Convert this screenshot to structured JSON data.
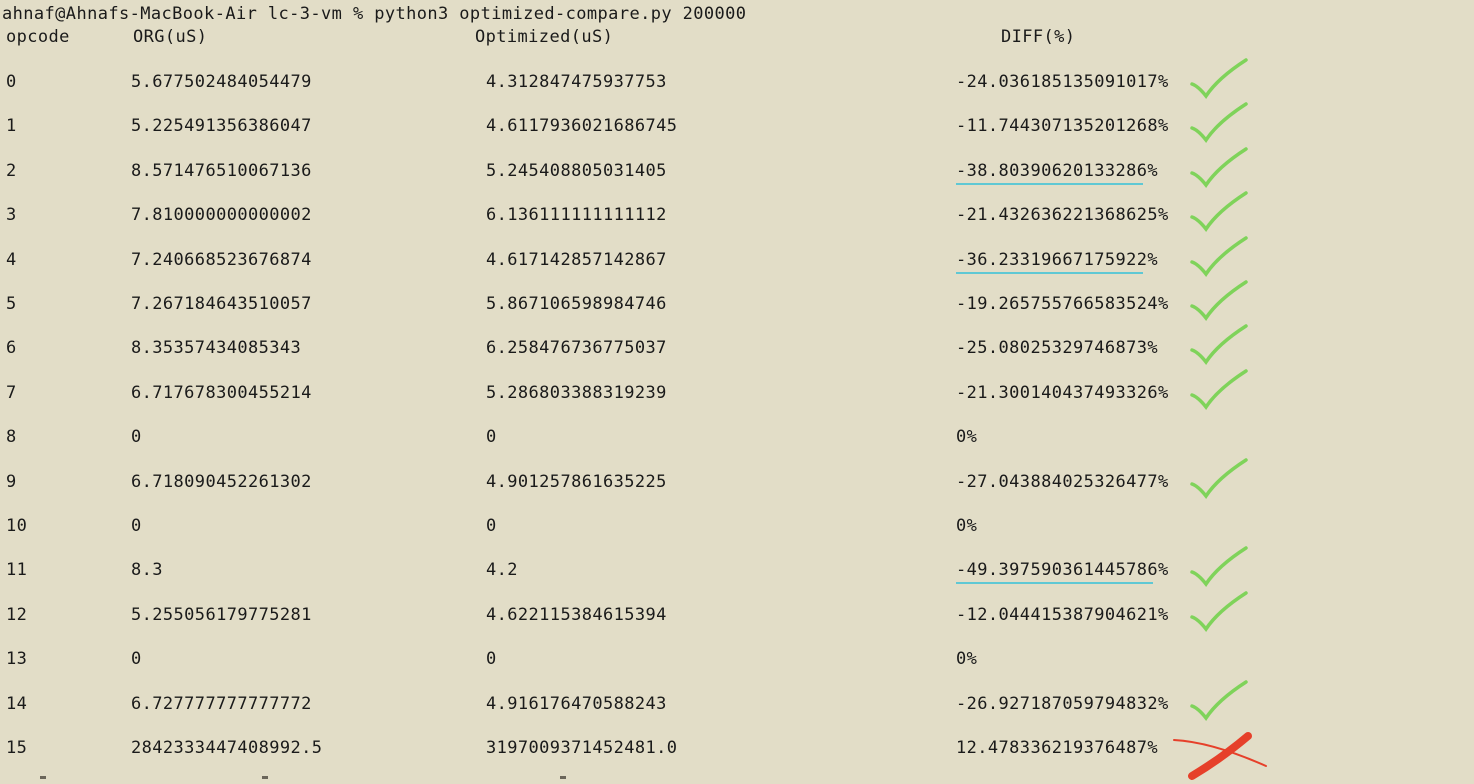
{
  "terminal": {
    "prompt": "ahnaf@Ahnafs-MacBook-Air lc-3-vm % python3 optimized-compare.py 200000",
    "headers": {
      "opcode": "opcode",
      "org": "ORG(uS)",
      "optimized": "Optimized(uS)",
      "diff": "DIFF(%)"
    },
    "rows": [
      {
        "opcode": "0",
        "org": "5.677502484054479",
        "optimized": "4.312847475937753",
        "diff": "-24.036185135091017%",
        "mark": "check",
        "underlined": false
      },
      {
        "opcode": "1",
        "org": "5.225491356386047",
        "optimized": "4.6117936021686745",
        "diff": "-11.744307135201268%",
        "mark": "check",
        "underlined": false
      },
      {
        "opcode": "2",
        "org": "8.571476510067136",
        "optimized": "5.245408805031405",
        "diff": "-38.80390620133286%",
        "mark": "check",
        "underlined": true
      },
      {
        "opcode": "3",
        "org": "7.810000000000002",
        "optimized": "6.136111111111112",
        "diff": "-21.432636221368625%",
        "mark": "check",
        "underlined": false
      },
      {
        "opcode": "4",
        "org": "7.240668523676874",
        "optimized": "4.617142857142867",
        "diff": "-36.23319667175922%",
        "mark": "check",
        "underlined": true
      },
      {
        "opcode": "5",
        "org": "7.267184643510057",
        "optimized": "5.867106598984746",
        "diff": "-19.265755766583524%",
        "mark": "check",
        "underlined": false
      },
      {
        "opcode": "6",
        "org": "8.35357434085343",
        "optimized": "6.258476736775037",
        "diff": "-25.08025329746873%",
        "mark": "check",
        "underlined": false
      },
      {
        "opcode": "7",
        "org": "6.717678300455214",
        "optimized": "5.286803388319239",
        "diff": "-21.300140437493326%",
        "mark": "check",
        "underlined": false
      },
      {
        "opcode": "8",
        "org": "0",
        "optimized": "0",
        "diff": "0%",
        "mark": "none",
        "underlined": false
      },
      {
        "opcode": "9",
        "org": "6.718090452261302",
        "optimized": "4.901257861635225",
        "diff": "-27.043884025326477%",
        "mark": "check",
        "underlined": false
      },
      {
        "opcode": "10",
        "org": "0",
        "optimized": "0",
        "diff": "0%",
        "mark": "none",
        "underlined": false
      },
      {
        "opcode": "11",
        "org": "8.3",
        "optimized": "4.2",
        "diff": "-49.397590361445786%",
        "mark": "check",
        "underlined": true
      },
      {
        "opcode": "12",
        "org": "5.255056179775281",
        "optimized": "4.622115384615394",
        "diff": "-12.044415387904621%",
        "mark": "check",
        "underlined": false
      },
      {
        "opcode": "13",
        "org": "0",
        "optimized": "0",
        "diff": "0%",
        "mark": "none",
        "underlined": false
      },
      {
        "opcode": "14",
        "org": "6.727777777777772",
        "optimized": "4.916176470588243",
        "diff": "-26.927187059794832%",
        "mark": "check",
        "underlined": false
      },
      {
        "opcode": "15",
        "org": "2842333447408992.5",
        "optimized": "3197009371452481.0",
        "diff": "12.478336219376487%",
        "mark": "cross",
        "underlined": false
      }
    ],
    "colors": {
      "background": "#e2ddc7",
      "text": "#1a1a1a",
      "check": "#7fd35a",
      "cross": "#e6402a",
      "underline": "#5fc8d4"
    }
  }
}
